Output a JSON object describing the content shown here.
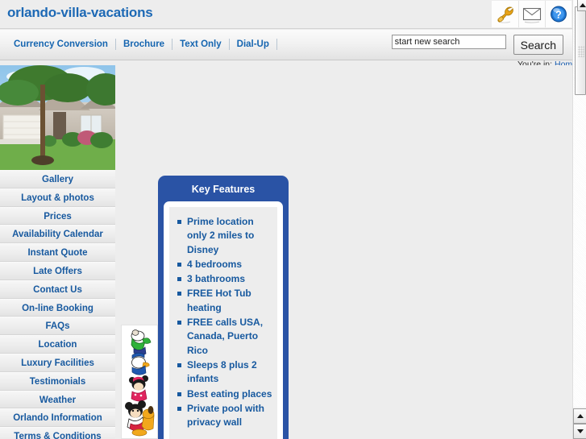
{
  "header": {
    "site_title": "orlando-villa-vacations",
    "icons": [
      {
        "name": "tools-wrench-icon",
        "label": "Tools"
      },
      {
        "name": "envelope-mail-icon",
        "label": "Contact"
      },
      {
        "name": "help-question-icon",
        "label": "Help"
      }
    ]
  },
  "nav": {
    "links": [
      {
        "label": "Currency Conversion"
      },
      {
        "label": "Brochure"
      },
      {
        "label": "Text Only"
      },
      {
        "label": "Dial-Up"
      }
    ]
  },
  "search": {
    "value": "start new search",
    "placeholder": "start new search",
    "button_label": "Search"
  },
  "breadcrumb": {
    "prefix": "You're in:",
    "current": "Home"
  },
  "sidebar": {
    "photo_alt": "villa-exterior-photo",
    "items": [
      {
        "label": "Gallery"
      },
      {
        "label": "Layout & photos"
      },
      {
        "label": "Prices"
      },
      {
        "label": "Availability Calendar"
      },
      {
        "label": "Instant Quote"
      },
      {
        "label": "Late Offers"
      },
      {
        "label": "Contact Us"
      },
      {
        "label": "On-line Booking"
      },
      {
        "label": "FAQs"
      },
      {
        "label": "Location"
      },
      {
        "label": "Luxury Facilities"
      },
      {
        "label": "Testimonials"
      },
      {
        "label": "Weather"
      },
      {
        "label": "Orlando Information"
      },
      {
        "label": "Terms & Conditions"
      }
    ]
  },
  "key_features": {
    "title": "Key Features",
    "items": [
      {
        "text": "Prime location only 2 miles to Disney"
      },
      {
        "text": "4 bedrooms"
      },
      {
        "text": "3 bathrooms"
      },
      {
        "text": "FREE Hot Tub heating"
      },
      {
        "text": "FREE calls USA, Canada, Puerto Rico"
      },
      {
        "text": "Sleeps 8 plus 2 infants"
      },
      {
        "text": "Best eating places"
      },
      {
        "text": "Private pool with privacy wall"
      }
    ]
  },
  "decor": {
    "disney_characters_alt": "disney-characters-image"
  },
  "colors": {
    "brand_blue": "#17599f",
    "panel_blue": "#2a53a5",
    "page_bg": "#ededed",
    "link_blue": "#1565b0"
  }
}
